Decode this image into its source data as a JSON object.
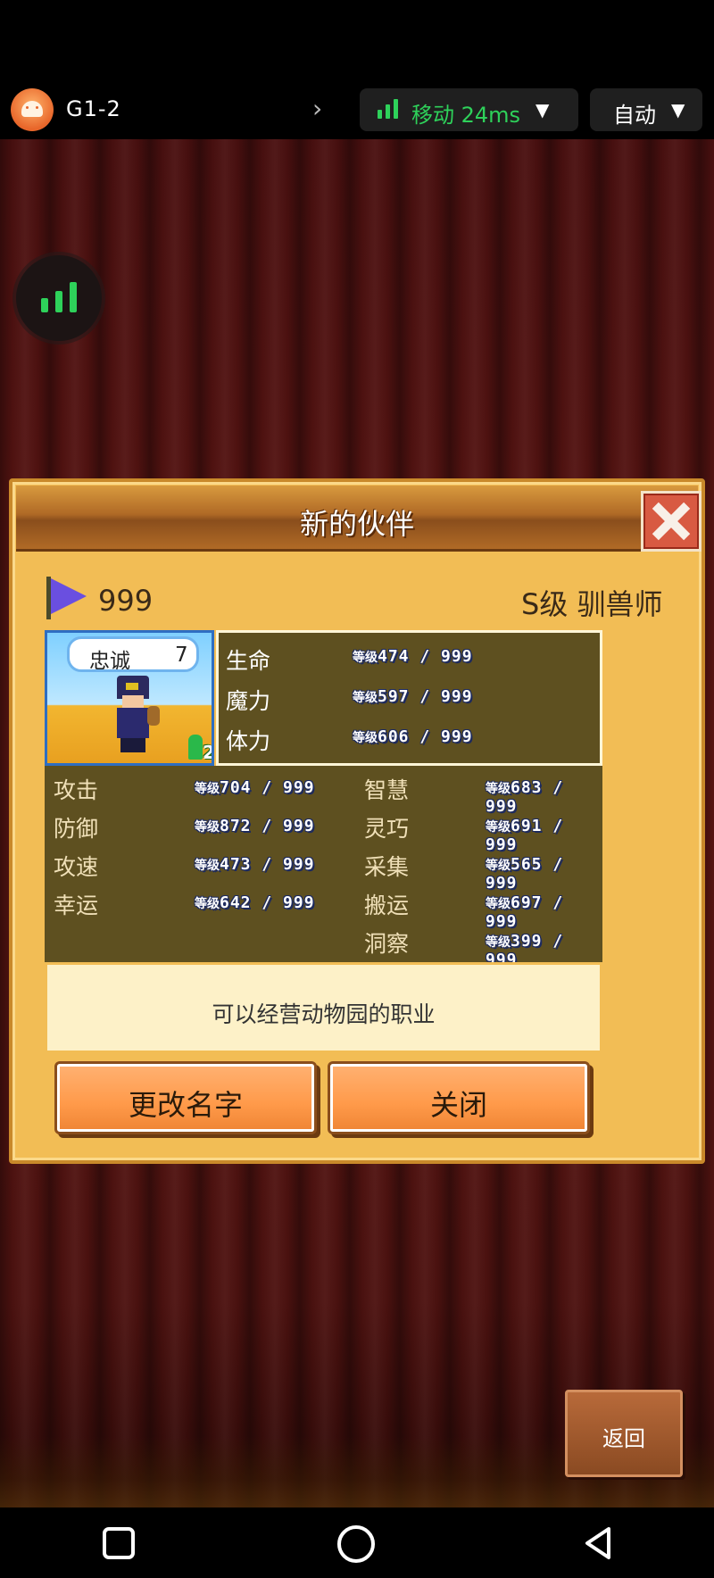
{
  "topbar": {
    "game_id": "G1-2",
    "network": "移动 24ms",
    "quality": "自动",
    "colors": {
      "network_green": "#2ed15a"
    }
  },
  "dialog": {
    "title": "新的伙伴",
    "fame": "999",
    "rank_class": "S级 驯兽师",
    "loyalty_label": "忠诚",
    "loyalty_value": "7",
    "badge_count": "2",
    "level_prefix": "等级",
    "vitals": [
      {
        "name": "生命",
        "value": "474 / 999"
      },
      {
        "name": "魔力",
        "value": "597 / 999"
      },
      {
        "name": "体力",
        "value": "606 / 999"
      }
    ],
    "stats_left": [
      {
        "name": "攻击",
        "value": "704 / 999"
      },
      {
        "name": "防御",
        "value": "872 / 999"
      },
      {
        "name": "攻速",
        "value": "473 / 999"
      },
      {
        "name": "幸运",
        "value": "642 / 999"
      }
    ],
    "stats_right": [
      {
        "name": "智慧",
        "value": "683 / 999"
      },
      {
        "name": "灵巧",
        "value": "691 / 999"
      },
      {
        "name": "采集",
        "value": "565 / 999"
      },
      {
        "name": "搬运",
        "value": "697 / 999"
      },
      {
        "name": "洞察",
        "value": "399 / 999"
      }
    ],
    "description": "可以经营动物园的职业",
    "rename_label": "更改名字",
    "close_label": "关闭"
  },
  "back_label": "返回"
}
